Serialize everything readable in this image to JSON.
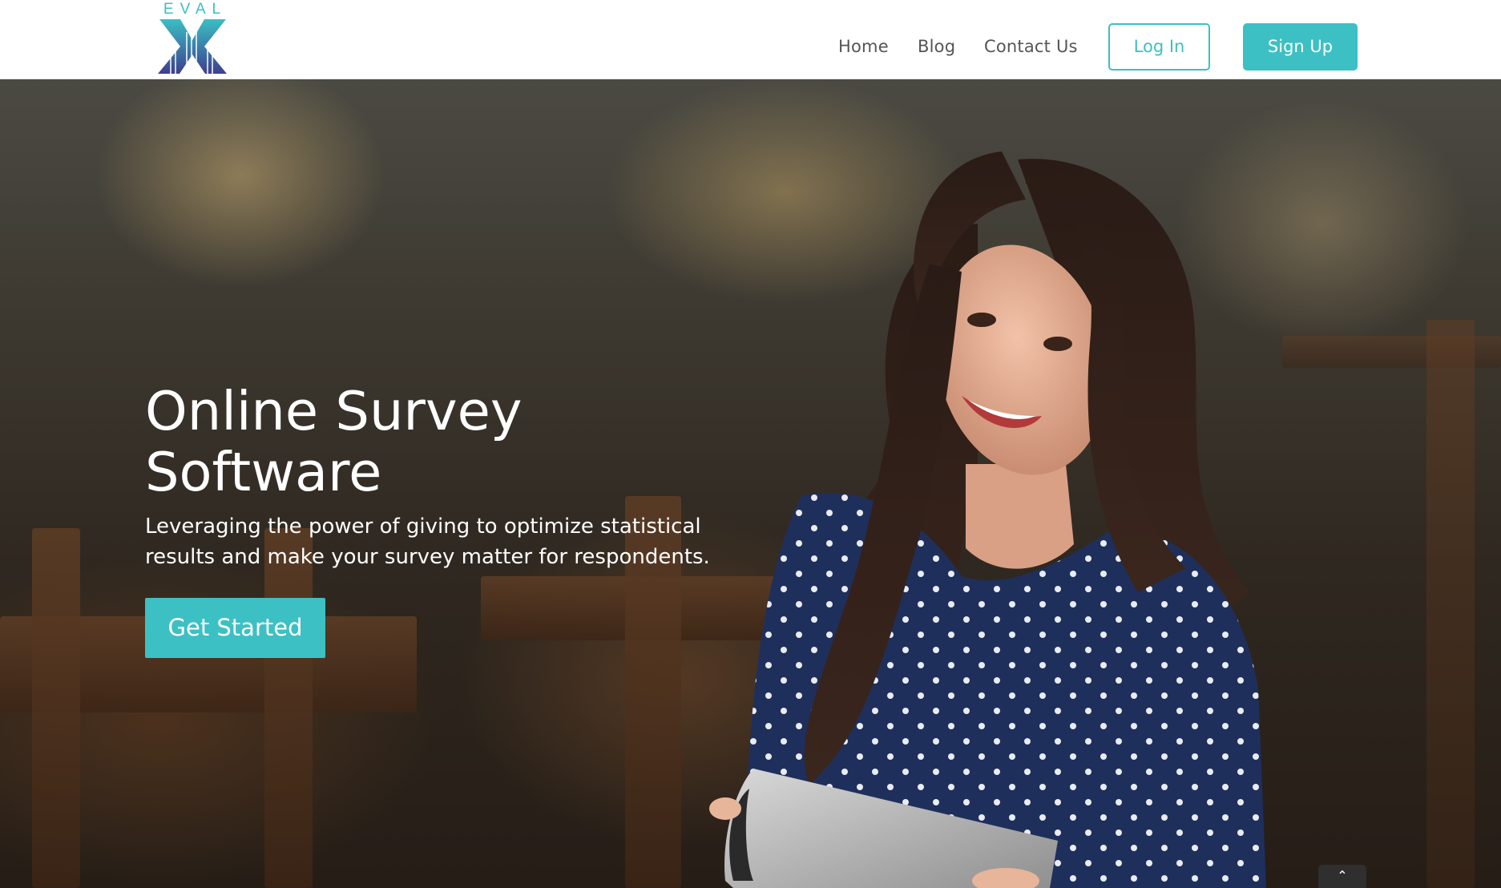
{
  "header": {
    "logo_text": "EVAL",
    "nav": {
      "home": "Home",
      "blog": "Blog",
      "contact": "Contact Us"
    },
    "login_label": "Log In",
    "signup_label": "Sign Up"
  },
  "hero": {
    "title_line1": "Online Survey",
    "title_line2": "Software",
    "subtitle_line1": "Leveraging the power of giving to optimize statistical",
    "subtitle_line2": "results and make your survey matter for respondents.",
    "cta_label": "Get Started"
  },
  "scroll_top": {
    "icon": "chevron-up-icon",
    "glyph": "⌃"
  },
  "colors": {
    "accent": "#3cc0c4",
    "nav_text": "#555555",
    "logo_gradient_top": "#3bbfc4",
    "logo_gradient_bottom": "#3d3f8f"
  }
}
